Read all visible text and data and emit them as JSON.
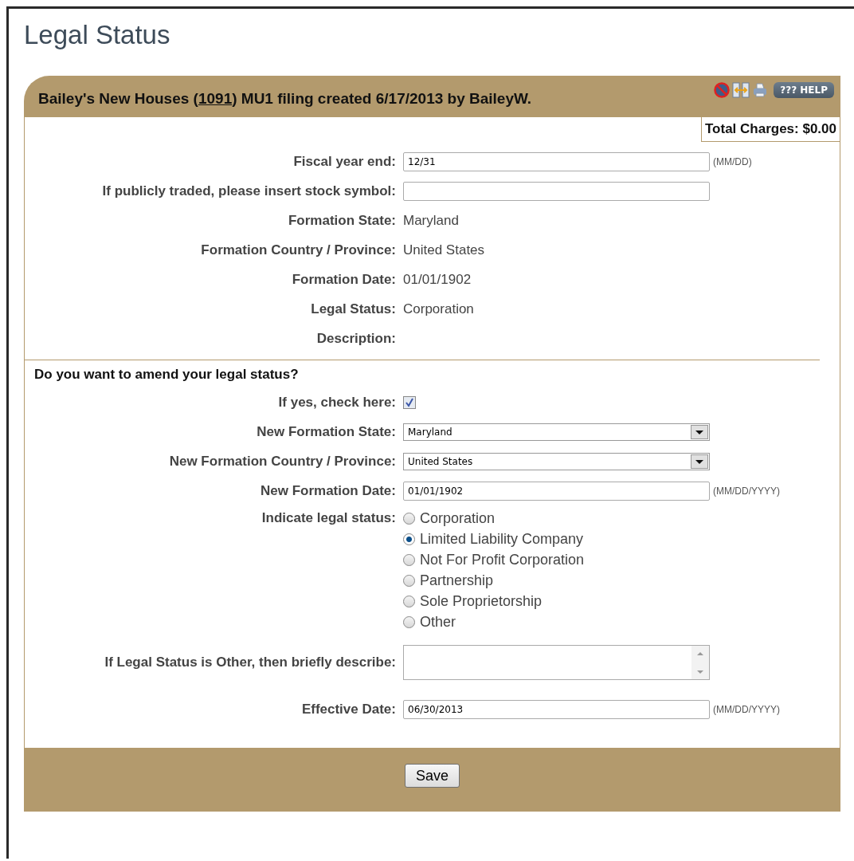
{
  "page_title": "Legal Status",
  "header": {
    "title_before": "Bailey's New Houses (",
    "link": "1091",
    "title_after": ") MU1 filing created 6/17/2013 by BaileyW.",
    "help_label": "??? HELP"
  },
  "total_charges": "Total Charges: $0.00",
  "rows": [
    {
      "kind": "input",
      "label": "Fiscal year end:",
      "value": "12/31",
      "hint": "(MM/DD)"
    },
    {
      "kind": "input",
      "label": "If publicly traded, please insert stock symbol:"
    },
    {
      "kind": "static",
      "label": "Formation State:",
      "value": "Maryland"
    },
    {
      "kind": "static",
      "label": "Formation Country / Province:",
      "value": "United States"
    },
    {
      "kind": "static",
      "label": "Formation Date:",
      "value": "01/01/1902"
    },
    {
      "kind": "static",
      "label": "Legal Status:",
      "value": "Corporation"
    },
    {
      "kind": "static",
      "label": "Description:"
    }
  ],
  "amend_heading": "Do you want to amend your legal status?",
  "amend_rows": [
    {
      "kind": "checkbox",
      "label": "If yes, check here:",
      "checked": true
    },
    {
      "kind": "select",
      "label": "New Formation State:",
      "value": "Maryland"
    },
    {
      "kind": "select",
      "label": "New Formation Country / Province:",
      "value": "United States"
    },
    {
      "kind": "input",
      "label": "New Formation Date:",
      "value": "01/01/1902",
      "hint": "(MM/DD/YYYY)"
    },
    {
      "kind": "radio",
      "label": "Indicate legal status:",
      "options": [
        {
          "label": "Corporation",
          "selected": false
        },
        {
          "label": "Limited Liability Company",
          "selected": true
        },
        {
          "label": "Not For Profit Corporation",
          "selected": false
        },
        {
          "label": "Partnership",
          "selected": false
        },
        {
          "label": "Sole Proprietorship",
          "selected": false
        },
        {
          "label": "Other",
          "selected": false
        }
      ]
    },
    {
      "kind": "textarea",
      "label": "If Legal Status is Other, then briefly describe:"
    },
    {
      "kind": "input",
      "label": "Effective Date:",
      "value": "06/30/2013",
      "hint": "(MM/DD/YYYY)"
    }
  ],
  "save_button": "Save"
}
